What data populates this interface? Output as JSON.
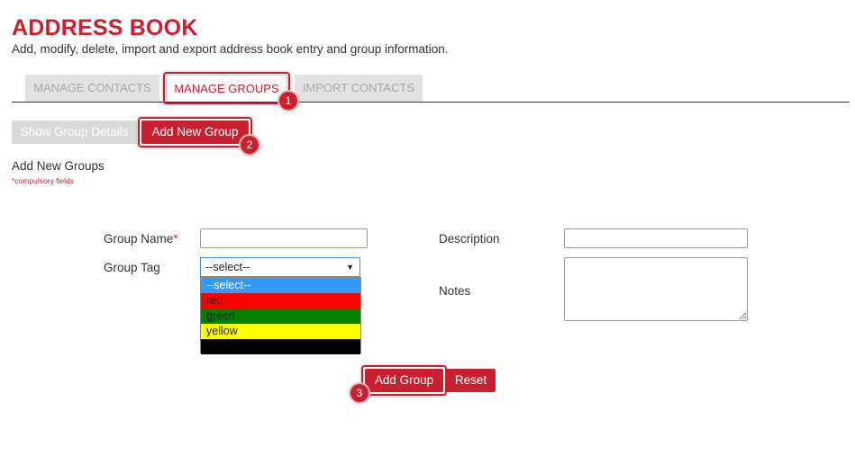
{
  "header": {
    "title": "ADDRESS BOOK",
    "subtitle": "Add, modify, delete, import and export address book entry and group information."
  },
  "tabs": [
    {
      "label": "MANAGE CONTACTS",
      "active": false
    },
    {
      "label": "MANAGE GROUPS",
      "active": true
    },
    {
      "label": "IMPORT CONTACTS",
      "active": false
    }
  ],
  "actions": {
    "show_group_details": "Show Group Details",
    "add_new_group": "Add New Group"
  },
  "form": {
    "section_title": "Add New Groups",
    "compulsory_note": "*compulsory fields",
    "group_name_label": "Group Name",
    "required_mark": "*",
    "group_name_value": "",
    "group_tag_label": "Group Tag",
    "group_tag_selected": "--select--",
    "group_tag_options": [
      {
        "label": "--select--",
        "color": "#3399ff",
        "highlighted": true
      },
      {
        "label": "red",
        "color": "#ff0000"
      },
      {
        "label": "green",
        "color": "#008000"
      },
      {
        "label": "yellow",
        "color": "#ffff00"
      },
      {
        "label": "",
        "color": "#000000"
      }
    ],
    "description_label": "Description",
    "description_value": "",
    "notes_label": "Notes",
    "notes_value": "",
    "submit_label": "Add Group",
    "reset_label": "Reset"
  },
  "callouts": [
    "1",
    "2",
    "3"
  ],
  "colors": {
    "accent": "#c8202f"
  }
}
